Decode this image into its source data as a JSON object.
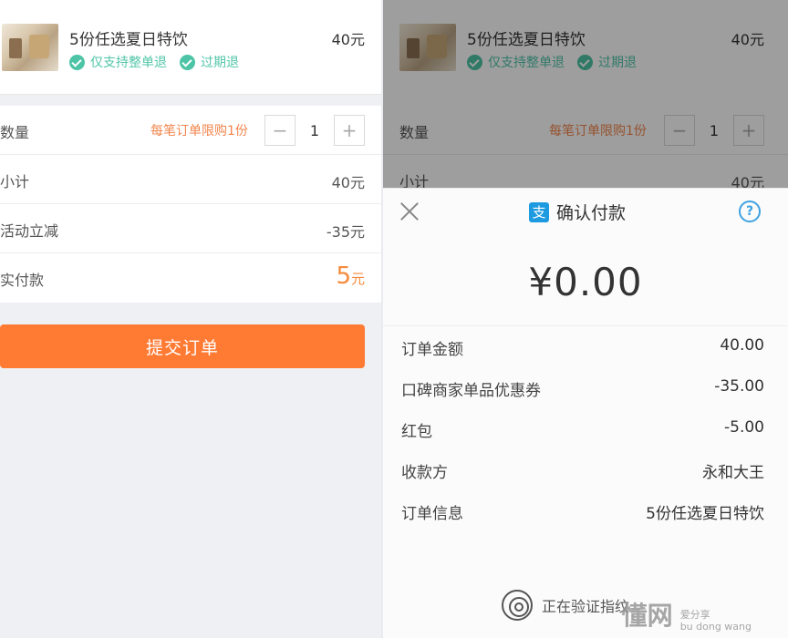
{
  "product": {
    "name": "5份任选夏日特饮",
    "price": "40元",
    "tags": [
      "仅支持整单退",
      "过期退"
    ]
  },
  "order_form": {
    "quantity_label": "数量",
    "limit_text": "每笔订单限购1份",
    "minus": "−",
    "plus": "+",
    "quantity": "1",
    "subtotal_label": "小计",
    "subtotal_value": "40元",
    "discount_label": "活动立减",
    "discount_value": "-35元",
    "pay_label": "实付款",
    "pay_number": "5",
    "pay_unit": "元"
  },
  "submit_label": "提交订单",
  "payment_sheet": {
    "logo_char": "支",
    "title": "确认付款",
    "help": "?",
    "amount": "¥0.00",
    "rows": [
      {
        "label": "订单金额",
        "value": "40.00"
      },
      {
        "label": "口碑商家单品优惠券",
        "value": "-35.00"
      },
      {
        "label": "红包",
        "value": "-5.00"
      },
      {
        "label": "收款方",
        "value": "永和大王"
      },
      {
        "label": "订单信息",
        "value": "5份任选夏日特饮"
      }
    ],
    "verify_text": "正在验证指纹"
  },
  "watermark": {
    "main": "懂网",
    "sub1": "爱分享",
    "sub2": "bu dong wang"
  },
  "colors": {
    "accent_orange": "#ff7a33",
    "tag_green": "#4cc4a5",
    "alipay_blue": "#1e9ae0"
  }
}
